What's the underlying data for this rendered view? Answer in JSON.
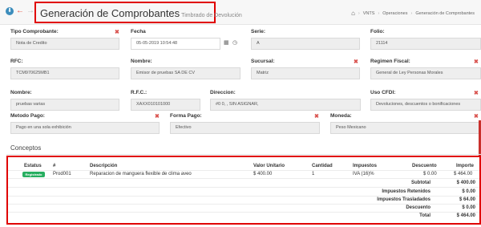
{
  "header": {
    "title": "Generación de Comprobantes",
    "subtitle": "Timbrado de Devolución",
    "breadcrumb": [
      "VNTS",
      "Operaciones",
      "Generación de Comprobantes"
    ]
  },
  "form": {
    "tipo_comprobante": {
      "label": "Tipo Comprobante:",
      "value": "Nota de Credito"
    },
    "fecha": {
      "label": "Fecha",
      "value": "05-05-2019 10:54:48"
    },
    "serie": {
      "label": "Serie:",
      "value": "A"
    },
    "folio": {
      "label": "Folio:",
      "value": "21114"
    },
    "rfc": {
      "label": "RFC:",
      "value": "TCM970625MB1"
    },
    "nombre": {
      "label": "Nombre:",
      "value": "Emisor de pruebas SA DE CV"
    },
    "sucursal": {
      "label": "Sucursal:",
      "value": "Matriz"
    },
    "regimen_fiscal": {
      "label": "Regimen Fiscal:",
      "value": "General de Ley Personas Morales"
    },
    "nombre_receptor": {
      "label": "Nombre:",
      "value": "pruebas varias"
    },
    "rfc_receptor": {
      "label": "R.F.C.:",
      "value": "XAXX010101000"
    },
    "direccion": {
      "label": "Direccion:",
      "value": "#0 0, , SIN ASIGNAR,"
    },
    "uso_cfdi": {
      "label": "Uso CFDI:",
      "value": "Devoluciones, descuentos o bonificaciones"
    },
    "metodo_pago": {
      "label": "Metodo Pago:",
      "value": "Pago en una sola exhibición"
    },
    "forma_pago": {
      "label": "Forma Pago:",
      "value": "Efectivo"
    },
    "moneda": {
      "label": "Moneda:",
      "value": "Peso Mexicano"
    }
  },
  "conceptos": {
    "title": "Conceptos",
    "columns": [
      "Estatus",
      "#",
      "Descripción",
      "Valor Unitario",
      "Cantidad",
      "Impuestos",
      "Descuento",
      "Importe"
    ],
    "row": {
      "estatus": "Registrado",
      "num": "Prod001",
      "descripcion": "Reparacion de manguera flexible de clima aveo",
      "valor_unitario": "$ 400.00",
      "cantidad": "1",
      "impuestos": "IVA (16)%",
      "descuento": "$ 0.00",
      "importe": "$ 464.00"
    },
    "totals": [
      {
        "label": "Subtotal",
        "value": "$ 400.00"
      },
      {
        "label": "Impuestos Retenidos",
        "value": "$ 0.00"
      },
      {
        "label": "Impuestos Trasladados",
        "value": "$ 64.00"
      },
      {
        "label": "Descuento",
        "value": "$ 0.00"
      },
      {
        "label": "Total",
        "value": "$ 464.00"
      }
    ]
  },
  "colors": {
    "accent": "#3c8dbc",
    "danger": "#e00000",
    "status_green": "#27ae60"
  }
}
